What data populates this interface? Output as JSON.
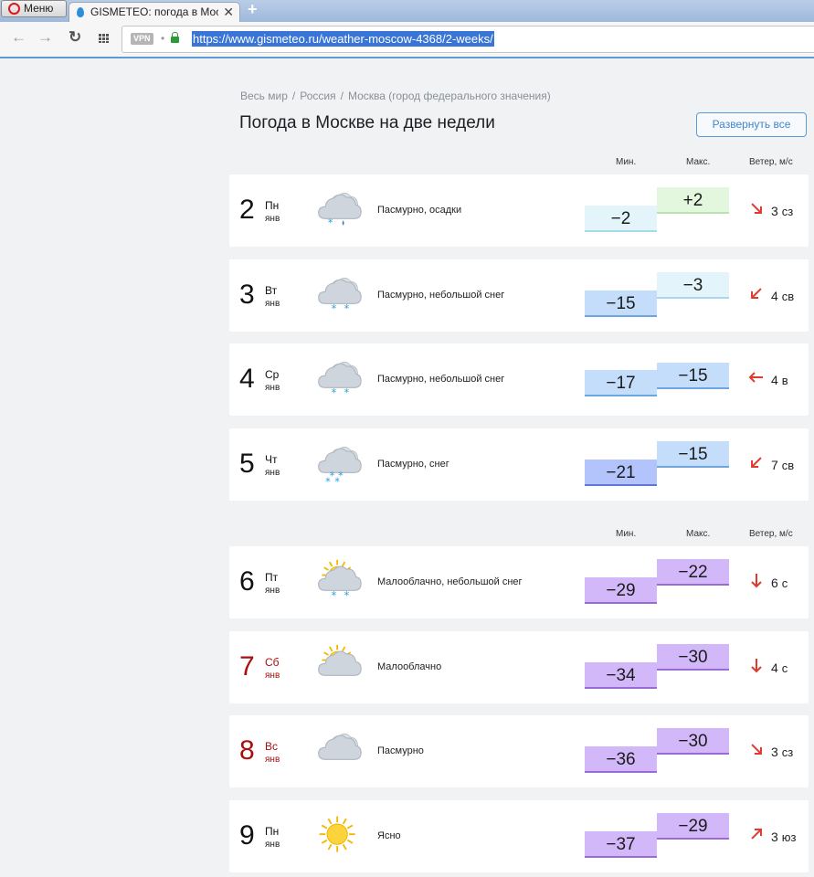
{
  "browser": {
    "menu_label": "Меню",
    "tab_title": "GISMETEO: погода в Моск",
    "url": "https://www.gismeteo.ru/weather-moscow-4368/2-weeks/",
    "vpn_label": "VPN"
  },
  "breadcrumb": [
    "Весь мир",
    "Россия",
    "Москва (город федерального значения)"
  ],
  "page_title": "Погода в Москве на две недели",
  "expand_button_label": "Развернуть все",
  "columns": {
    "min": "Мин.",
    "max": "Макс.",
    "wind": "Ветер, м/с"
  },
  "colors": {
    "t_warm_bg": "#e3f6de",
    "t_warm_border": "#b9e3ad",
    "t_pale_bg": "#e3f5fb",
    "t_pale_border": "#a9d8ec",
    "t_light_bg": "#c3ddfb",
    "t_light_border": "#6ea5df",
    "t_blue_bg": "#b3c3fb",
    "t_blue_border": "#5f75d8",
    "t_violet_bg": "#d2b8f8",
    "t_violet_border": "#9b6ad6",
    "wind_arrow": "#e03a2f"
  },
  "days": [
    {
      "day": "2",
      "dow": "Пн",
      "month": "янв",
      "weekend": false,
      "icon": "cloud-rain-snow-icon",
      "desc": "Пасмурно, осадки",
      "t_min": "−2",
      "t_max": "+2",
      "min_val": -2,
      "max_val": 2,
      "wind_speed": "3",
      "wind_dir": "сз",
      "arrow": "arrow-down-right-icon"
    },
    {
      "day": "3",
      "dow": "Вт",
      "month": "янв",
      "weekend": false,
      "icon": "cloud-light-snow-icon",
      "desc": "Пасмурно, небольшой снег",
      "t_min": "−15",
      "t_max": "−3",
      "min_val": -15,
      "max_val": -3,
      "wind_speed": "4",
      "wind_dir": "св",
      "arrow": "arrow-down-left-icon"
    },
    {
      "day": "4",
      "dow": "Ср",
      "month": "янв",
      "weekend": false,
      "icon": "cloud-light-snow-icon",
      "desc": "Пасмурно, небольшой снег",
      "t_min": "−17",
      "t_max": "−15",
      "min_val": -17,
      "max_val": -15,
      "wind_speed": "4",
      "wind_dir": "в",
      "arrow": "arrow-left-icon"
    },
    {
      "day": "5",
      "dow": "Чт",
      "month": "янв",
      "weekend": false,
      "icon": "cloud-snow-icon",
      "desc": "Пасмурно, снег",
      "t_min": "−21",
      "t_max": "−15",
      "min_val": -21,
      "max_val": -15,
      "wind_speed": "7",
      "wind_dir": "св",
      "arrow": "arrow-down-left-icon"
    },
    {
      "day": "6",
      "dow": "Пт",
      "month": "янв",
      "weekend": false,
      "icon": "sun-cloud-light-snow-icon",
      "desc": "Малооблачно, небольшой снег",
      "t_min": "−29",
      "t_max": "−22",
      "min_val": -29,
      "max_val": -22,
      "wind_speed": "6",
      "wind_dir": "с",
      "arrow": "arrow-down-icon"
    },
    {
      "day": "7",
      "dow": "Сб",
      "month": "янв",
      "weekend": true,
      "icon": "sun-cloud-icon",
      "desc": "Малооблачно",
      "t_min": "−34",
      "t_max": "−30",
      "min_val": -34,
      "max_val": -30,
      "wind_speed": "4",
      "wind_dir": "с",
      "arrow": "arrow-down-icon"
    },
    {
      "day": "8",
      "dow": "Вс",
      "month": "янв",
      "weekend": true,
      "icon": "cloud-icon",
      "desc": "Пасмурно",
      "t_min": "−36",
      "t_max": "−30",
      "min_val": -36,
      "max_val": -30,
      "wind_speed": "3",
      "wind_dir": "сз",
      "arrow": "arrow-down-right-icon"
    },
    {
      "day": "9",
      "dow": "Пн",
      "month": "янв",
      "weekend": false,
      "icon": "sun-icon",
      "desc": "Ясно",
      "t_min": "−37",
      "t_max": "−29",
      "min_val": -37,
      "max_val": -29,
      "wind_speed": "3",
      "wind_dir": "юз",
      "arrow": "arrow-up-right-icon"
    }
  ]
}
